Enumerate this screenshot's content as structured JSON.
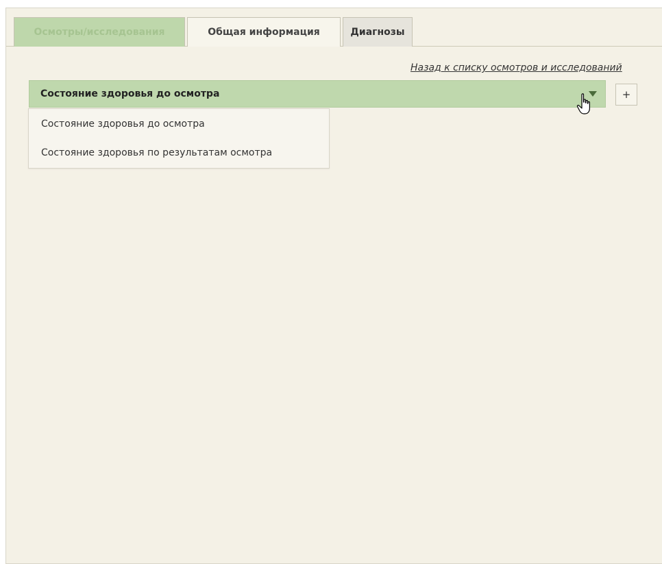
{
  "tabs": [
    {
      "label": "Осмотры/исследования"
    },
    {
      "label": "Общая информация"
    },
    {
      "label": "Диагнозы"
    }
  ],
  "back_link": "Назад к списку осмотров и исследований",
  "combo": {
    "value": "Состояние здоровья до осмотра",
    "add_label": "+"
  },
  "dropdown": {
    "options": [
      "Состояние здоровья до осмотра",
      "Состояние здоровья по результатам осмотра"
    ]
  },
  "colors": {
    "active_tab": "#bed7ab",
    "combo_bg": "#bfd8ad",
    "panel_bg": "#f4f1e6"
  },
  "icons": [
    "chevron-down-icon",
    "hand-pointer-icon"
  ]
}
